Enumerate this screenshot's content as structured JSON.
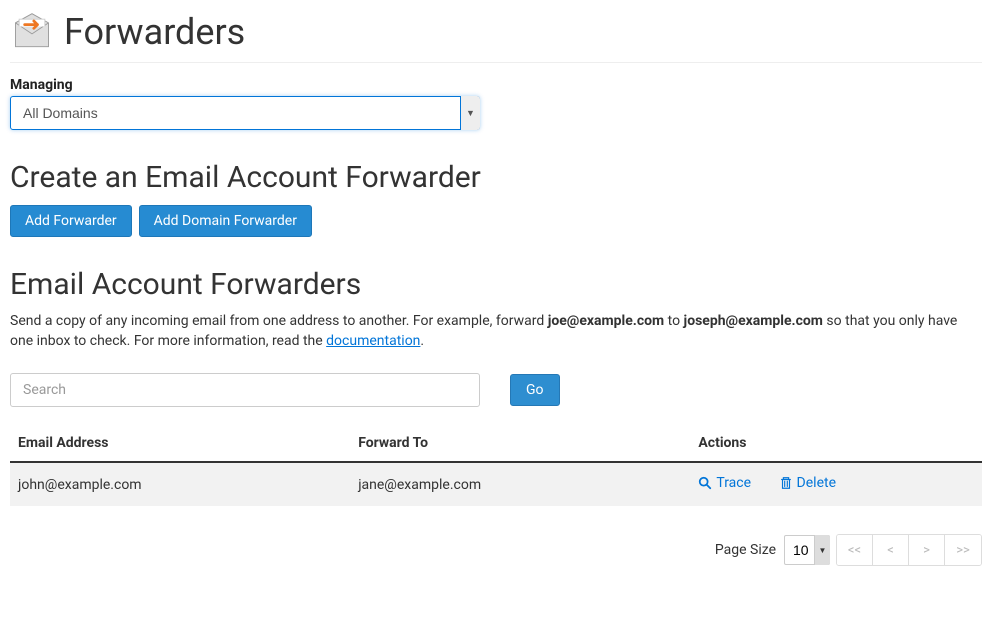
{
  "header": {
    "title": "Forwarders"
  },
  "managing": {
    "label": "Managing",
    "selected": "All Domains"
  },
  "sections": {
    "create_title": "Create an Email Account Forwarder",
    "list_title": "Email Account Forwarders"
  },
  "buttons": {
    "add_forwarder": "Add Forwarder",
    "add_domain_forwarder": "Add Domain Forwarder",
    "go": "Go"
  },
  "description": {
    "text_prefix": "Send a copy of any incoming email from one address to another. For example, forward ",
    "bold1": "joe@example.com",
    "text_mid": " to ",
    "bold2": "joseph@example.com",
    "text_suffix": " so that you only have one inbox to check. For more information, read the ",
    "link_text": "documentation",
    "text_end": "."
  },
  "search": {
    "placeholder": "Search"
  },
  "table": {
    "headers": {
      "email": "Email Address",
      "forward_to": "Forward To",
      "actions": "Actions"
    },
    "rows": [
      {
        "email": "john@example.com",
        "forward_to": "jane@example.com"
      }
    ],
    "actions": {
      "trace": "Trace",
      "delete": "Delete"
    }
  },
  "pagination": {
    "page_size_label": "Page Size",
    "page_size_value": "10",
    "first": "<<",
    "prev": "<",
    "next": ">",
    "last": ">>"
  }
}
